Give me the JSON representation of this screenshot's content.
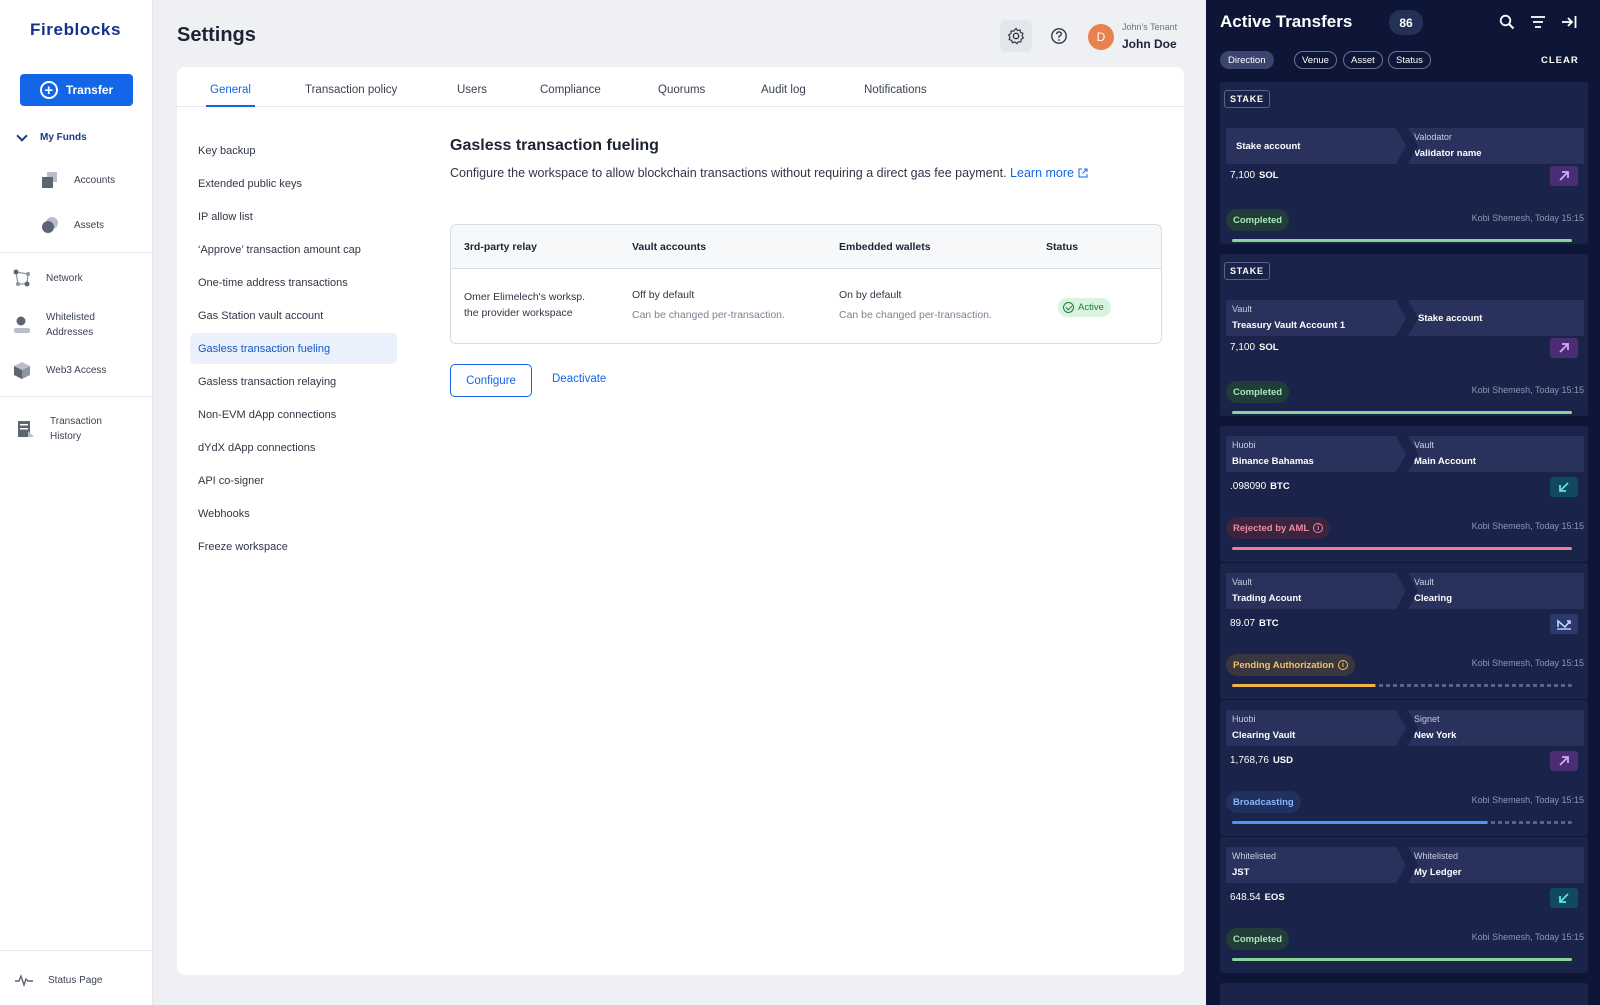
{
  "app": {
    "brand": "Fireblocks",
    "accent": "#1366e8"
  },
  "leftnav": {
    "transfer_label": "Transfer",
    "my_funds_label": "My Funds",
    "accounts_label": "Accounts",
    "assets_label": "Assets",
    "network_label": "Network",
    "whitelisted_label_1": "Whitelisted",
    "whitelisted_label_2": "Addresses",
    "web3_label": "Web3 Access",
    "history_label_1": "Transaction",
    "history_label_2": "History",
    "status_page_label": "Status Page"
  },
  "header": {
    "title": "Settings",
    "tenant": "John's Tenant",
    "user_name": "John Doe",
    "avatar_initial": "D"
  },
  "tabs": [
    "General",
    "Transaction policy",
    "Users",
    "Compliance",
    "Quorums",
    "Audit log",
    "Notifications"
  ],
  "subnav": [
    "Key backup",
    "Extended public keys",
    "IP allow list",
    "‘Approve’ transaction amount cap",
    "One-time address transactions",
    "Gas Station vault account",
    "Gasless transaction fueling",
    "Gasless transaction relaying",
    "Non-EVM dApp connections",
    "dYdX dApp connections",
    "API co-signer",
    "Webhooks",
    "Freeze workspace"
  ],
  "section": {
    "title": "Gasless transaction fueling",
    "description": "Configure the workspace to allow blockchain transactions without requiring a direct gas fee payment.",
    "learn_more": "Learn more",
    "table": {
      "headers": [
        "3rd-party relay",
        "Vault accounts",
        "Embedded wallets",
        "Status"
      ],
      "row": {
        "relay_line1": "Omer Elimelech's worksp.",
        "relay_line2": "the provider workspace",
        "vault_main": "Off by default",
        "vault_sub": "Can be changed per-transaction.",
        "wallets_main": "On by default",
        "wallets_sub": "Can be changed per-transaction.",
        "status": "Active"
      }
    },
    "configure_label": "Configure",
    "deactivate_label": "Deactivate"
  },
  "active_transfers": {
    "title": "Active Transfers",
    "count": "86",
    "filters": [
      "Direction",
      "Venue",
      "Asset",
      "Status"
    ],
    "clear_label": "CLEAR",
    "cards": [
      {
        "tag": "STAKE",
        "from_label": "",
        "from_value": "Stake account",
        "to_label": "Valodator",
        "to_value": "Validator name",
        "amount": "7,100",
        "asset": "SOL",
        "status": "Completed",
        "meta": "Kobi Shemesh, Today 15:15"
      },
      {
        "tag": "STAKE",
        "from_label": "Vault",
        "from_value": "Treasury Vault Account 1",
        "to_label": "",
        "to_value": "Stake account",
        "amount": "7,100",
        "asset": "SOL",
        "status": "Completed",
        "meta": "Kobi Shemesh, Today 15:15"
      },
      {
        "tag": "",
        "from_label": "Huobi",
        "from_value": "Binance Bahamas",
        "to_label": "Vault",
        "to_value": "Main Account",
        "amount": ".098090",
        "asset": "BTC",
        "status": "Rejected by AML",
        "meta": "Kobi Shemesh, Today 15:15"
      },
      {
        "tag": "",
        "from_label": "Vault",
        "from_value": "Trading Acount",
        "to_label": "Vault",
        "to_value": "Clearing",
        "amount": "89.07",
        "asset": "BTC",
        "status": "Pending Authorization",
        "meta": "Kobi Shemesh, Today 15:15"
      },
      {
        "tag": "",
        "from_label": "Huobi",
        "from_value": "Clearing Vault",
        "to_label": "Signet",
        "to_value": "New York",
        "amount": "1,768,76",
        "asset": "USD",
        "status": "Broadcasting",
        "meta": "Kobi Shemesh, Today 15:15"
      },
      {
        "tag": "",
        "from_label": "Whitelisted",
        "from_value": "JST",
        "to_label": "Whitelisted",
        "to_value": "My Ledger",
        "amount": "648.54",
        "asset": "EOS",
        "status": "Completed",
        "meta": "Kobi Shemesh, Today 15:15"
      }
    ],
    "progress": [
      1.0,
      1.0,
      1.0,
      0.42,
      0.75,
      1.0
    ],
    "colors": {
      "completed": "#8ad49a",
      "rejected": "#f07f96",
      "pending": "#f3b445",
      "broadcasting": "#4f95f2",
      "panel_bg": "#0d1636",
      "out_arrow": "#a35cd6",
      "in_arrow": "#1fa3b8"
    }
  }
}
